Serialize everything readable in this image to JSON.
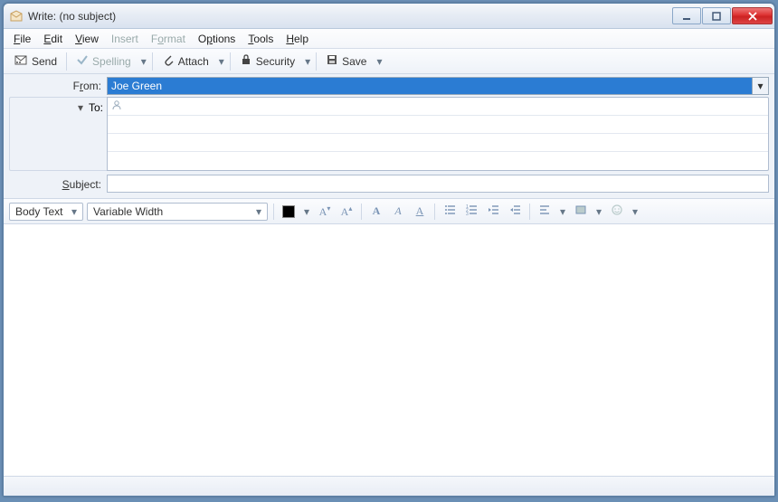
{
  "window": {
    "title": "Write: (no subject)"
  },
  "menu": {
    "file": "File",
    "edit": "Edit",
    "view": "View",
    "insert": "Insert",
    "format": "Format",
    "options": "Options",
    "tools": "Tools",
    "help": "Help"
  },
  "toolbar": {
    "send": "Send",
    "spelling": "Spelling",
    "attach": "Attach",
    "security": "Security",
    "save": "Save"
  },
  "fields": {
    "fromLabel": "From:",
    "fromValue": "Joe Green",
    "toLabel": "To:",
    "toValue": "",
    "subjectLabel": "Subject:",
    "subjectValue": ""
  },
  "format": {
    "paragraphStyle": "Body Text",
    "fontFamily": "Variable Width"
  },
  "body": ""
}
